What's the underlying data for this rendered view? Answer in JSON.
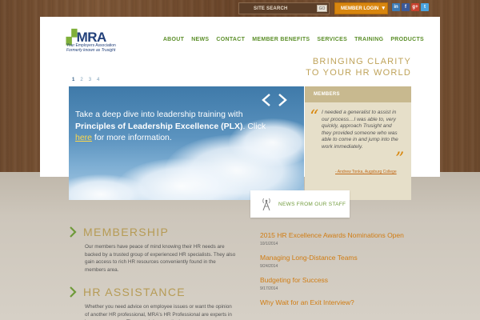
{
  "topbar": {
    "search_label": "SITE SEARCH",
    "search_button": "GO",
    "login_label": "MEMBER LOGIN",
    "social": [
      "in",
      "f",
      "g+",
      "t"
    ]
  },
  "logo": {
    "name": "MRA",
    "line1": "Your Employers Association",
    "line2": "Formerly known as Trusight"
  },
  "nav": {
    "items": [
      "ABOUT",
      "NEWS",
      "CONTACT",
      "MEMBER BENEFITS",
      "SERVICES",
      "TRAINING",
      "PRODUCTS"
    ]
  },
  "tagline": {
    "line1": "BRINGING CLARITY",
    "line2": "TO YOUR HR WORLD"
  },
  "pager": [
    "1",
    "2",
    "3",
    "4"
  ],
  "hero": {
    "line1": "Take a deep dive into leadership training with",
    "bold": "Principles of Leadership Excellence (PLX)",
    "after_bold": ". Click",
    "link": "here",
    "tail": " for more information."
  },
  "members": {
    "heading": "MEMBERS",
    "quote": "I needed a generalist to assist in our process…I was able to, very quickly, approach Trusight and they provided someone who was able to come in and jump into the work immediately.",
    "attribution": "- Andrew Tonka, Augsburg College"
  },
  "news": {
    "heading": "NEWS FROM OUR STAFF",
    "items": [
      {
        "title": "2015 HR Excellence Awards Nominations Open",
        "date": "10/1/2014"
      },
      {
        "title": "Managing Long-Distance Teams",
        "date": "9/24/2014"
      },
      {
        "title": "Budgeting for Success",
        "date": "9/17/2014"
      },
      {
        "title": "Why Wait for an Exit Interview?",
        "date": ""
      }
    ]
  },
  "sections": {
    "membership": {
      "title": "MEMBERSHIP",
      "body": "Our members have peace of mind knowing their HR needs are backed by a trusted group of experienced HR specialists. They also gain access to rich HR resources conveniently found in the members area."
    },
    "hr_assistance": {
      "title": "HR ASSISTANCE",
      "body": "Whether you need advice on employee issues or want the opinion of another HR professional, MRA's HR Professional are experts in human resources. They can bring practical"
    }
  },
  "colors": {
    "accent_orange": "#d8860f",
    "nav_green": "#5c8f2a",
    "gold": "#b69b55",
    "brand_blue": "#22407a"
  }
}
